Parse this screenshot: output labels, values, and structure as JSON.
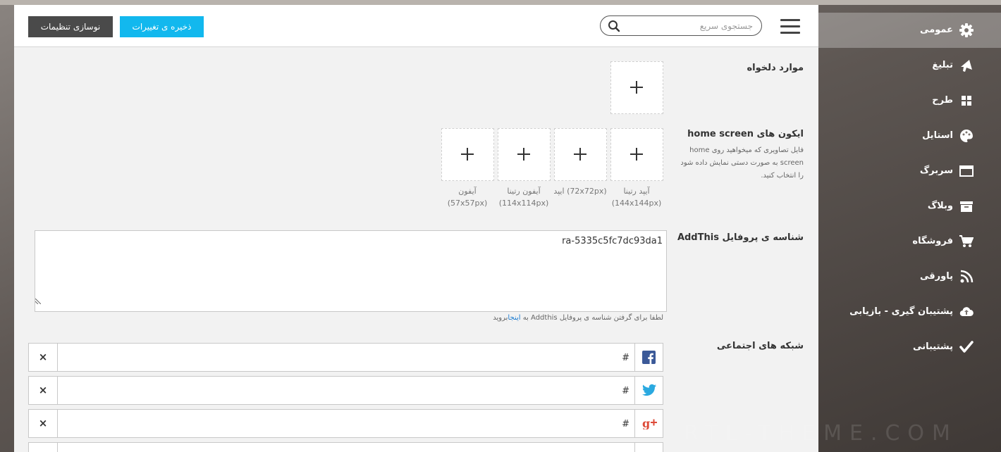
{
  "toolbar": {
    "reset_label": "نوسازی تنظیمات",
    "save_label": "ذخیره ی تغییرات",
    "search_placeholder": "جستجوی سریع"
  },
  "favorites": {
    "label": "موارد دلخواه"
  },
  "homescreen": {
    "label": "ایکون های home screen",
    "description": "فایل تصاویری که میخواهید روی home screen به صورت دستی نمایش داده شود را انتخاب کنید.",
    "slots": [
      {
        "name": "آیپد رتینا",
        "size": "(144x144px)"
      },
      {
        "name": "ایپد",
        "size": "(72x72px)"
      },
      {
        "name": "آیفون رتینا",
        "size": "(114x114px)"
      },
      {
        "name": "آیفون",
        "size": "(57x57px)"
      }
    ]
  },
  "addthis": {
    "label": "شناسه ی پروفایل AddThis",
    "value": "ra-5335c5fc7dc93da1",
    "hint_prefix": "لطفا برای گرفتن شناسه ی پروفایل Addthis به ",
    "hint_link": "اینجا",
    "hint_suffix": "بروید"
  },
  "social": {
    "label": "شبکه های اجتماعی",
    "remove_symbol": "×",
    "rows": [
      {
        "network": "facebook-icon",
        "value": "#",
        "color": "#3b5998"
      },
      {
        "network": "twitter-icon",
        "value": "#",
        "color": "#2aa9e0"
      },
      {
        "network": "google-plus-icon",
        "value": "#",
        "color": "#dd4b39"
      }
    ]
  },
  "sidebar": {
    "items": [
      {
        "label": "عمومی",
        "icon": "gear-icon"
      },
      {
        "label": "تبلیغ",
        "icon": "megaphone-icon"
      },
      {
        "label": "طرح",
        "icon": "grid-icon"
      },
      {
        "label": "استایل",
        "icon": "palette-icon"
      },
      {
        "label": "سربرگ",
        "icon": "window-icon"
      },
      {
        "label": "وبلاگ",
        "icon": "archive-icon"
      },
      {
        "label": "فروشگاه",
        "icon": "cart-icon"
      },
      {
        "label": "پاورقی",
        "icon": "rss-icon"
      },
      {
        "label": "پشتیبان گیری - بازیابی",
        "icon": "cloud-upload-icon"
      },
      {
        "label": "پشتیبانی",
        "icon": "check-icon"
      }
    ]
  },
  "watermark": "RTL-THEME.COM"
}
